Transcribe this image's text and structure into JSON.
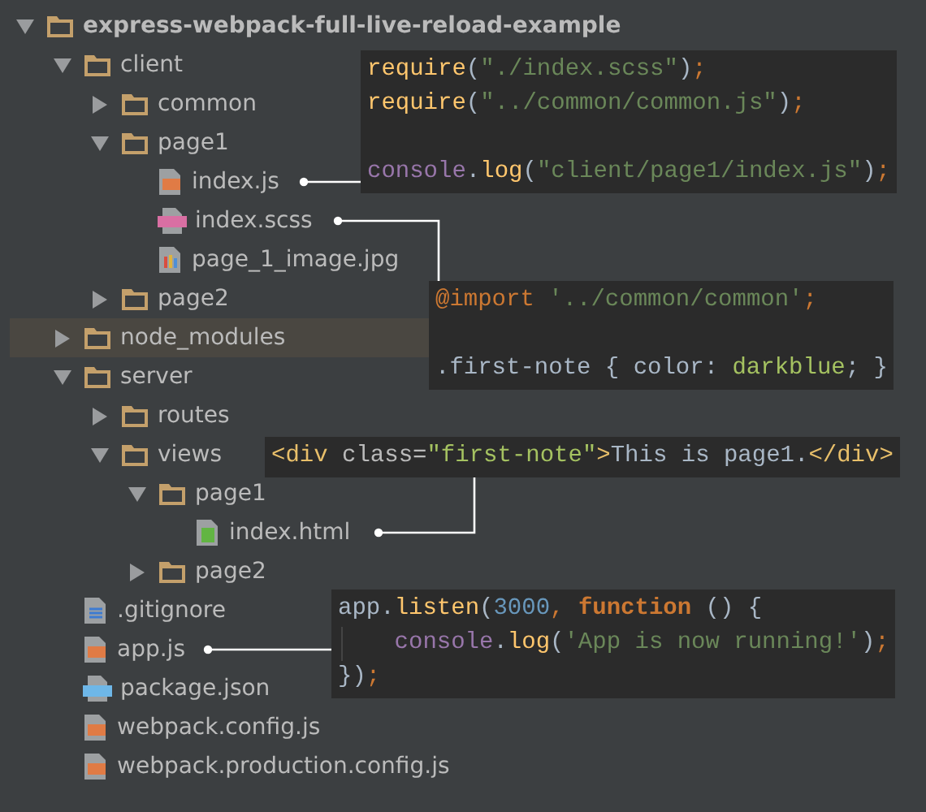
{
  "tree": [
    {
      "label": "express-webpack-full-live-reload-example",
      "kind": "folder",
      "expanded": true,
      "selected": false,
      "children": [
        {
          "label": "client",
          "kind": "folder",
          "expanded": true,
          "selected": false,
          "children": [
            {
              "label": "common",
              "kind": "folder",
              "expanded": false,
              "selected": false
            },
            {
              "label": "page1",
              "kind": "folder",
              "expanded": true,
              "selected": false,
              "children": [
                {
                  "label": "index.js",
                  "kind": "js",
                  "selected": false
                },
                {
                  "label": "index.scss",
                  "kind": "sass",
                  "selected": false
                },
                {
                  "label": "page_1_image.jpg",
                  "kind": "image",
                  "selected": false
                }
              ]
            },
            {
              "label": "page2",
              "kind": "folder",
              "expanded": false,
              "selected": false
            }
          ]
        },
        {
          "label": "node_modules",
          "kind": "folder",
          "expanded": false,
          "selected": true
        },
        {
          "label": "server",
          "kind": "folder",
          "expanded": true,
          "selected": false,
          "children": [
            {
              "label": "routes",
              "kind": "folder",
              "expanded": false,
              "selected": false
            },
            {
              "label": "views",
              "kind": "folder",
              "expanded": true,
              "selected": false,
              "children": [
                {
                  "label": "page1",
                  "kind": "folder",
                  "expanded": true,
                  "selected": false,
                  "children": [
                    {
                      "label": "index.html",
                      "kind": "html",
                      "selected": false
                    }
                  ]
                },
                {
                  "label": "page2",
                  "kind": "folder",
                  "expanded": false,
                  "selected": false
                }
              ]
            }
          ]
        },
        {
          "label": ".gitignore",
          "kind": "text",
          "selected": false
        },
        {
          "label": "app.js",
          "kind": "js",
          "selected": false
        },
        {
          "label": "package.json",
          "kind": "json",
          "selected": false
        },
        {
          "label": "webpack.config.js",
          "kind": "js",
          "selected": false
        },
        {
          "label": "webpack.production.config.js",
          "kind": "js",
          "selected": false
        }
      ]
    }
  ],
  "code_notes": [
    {
      "lines": [
        {
          "spaced": false,
          "indent": false,
          "tokens": [
            {
              "text": "require",
              "kind": "fn"
            },
            {
              "text": "(",
              "kind": "plain"
            },
            {
              "text": "\"./index.scss\"",
              "kind": "str"
            },
            {
              "text": ")",
              "kind": "plain"
            },
            {
              "text": ";",
              "kind": "punct"
            }
          ]
        },
        {
          "spaced": false,
          "indent": false,
          "tokens": [
            {
              "text": "require",
              "kind": "fn"
            },
            {
              "text": "(",
              "kind": "plain"
            },
            {
              "text": "\"../common/common.js\"",
              "kind": "str"
            },
            {
              "text": ")",
              "kind": "plain"
            },
            {
              "text": ";",
              "kind": "punct"
            }
          ]
        },
        {
          "spaced": true,
          "indent": false,
          "tokens": [
            {
              "text": "console",
              "kind": "obj"
            },
            {
              "text": ".",
              "kind": "plain"
            },
            {
              "text": "log",
              "kind": "fn"
            },
            {
              "text": "(",
              "kind": "plain"
            },
            {
              "text": "\"client/page1/index.js\"",
              "kind": "str"
            },
            {
              "text": ")",
              "kind": "plain"
            },
            {
              "text": ";",
              "kind": "punct"
            }
          ]
        }
      ]
    },
    {
      "lines": [
        {
          "spaced": false,
          "indent": false,
          "tokens": [
            {
              "text": "@import",
              "kind": "at"
            },
            {
              "text": " '../common/common'",
              "kind": "str"
            },
            {
              "text": ";",
              "kind": "punct"
            }
          ]
        },
        {
          "spaced": true,
          "indent": false,
          "tokens": [
            {
              "text": ".first-note { color: ",
              "kind": "plain"
            },
            {
              "text": "darkblue",
              "kind": "val"
            },
            {
              "text": "; }",
              "kind": "plain"
            }
          ]
        }
      ]
    },
    {
      "lines": [
        {
          "spaced": false,
          "indent": false,
          "tokens": [
            {
              "text": "<div ",
              "kind": "tag"
            },
            {
              "text": "class=",
              "kind": "attr"
            },
            {
              "text": "\"first-note\"",
              "kind": "val"
            },
            {
              "text": ">",
              "kind": "tag"
            },
            {
              "text": "This is page1.",
              "kind": "plain"
            },
            {
              "text": "</div>",
              "kind": "tag"
            }
          ]
        }
      ]
    },
    {
      "lines": [
        {
          "spaced": false,
          "indent": false,
          "tokens": [
            {
              "text": "app.",
              "kind": "plain"
            },
            {
              "text": "listen",
              "kind": "fn"
            },
            {
              "text": "(",
              "kind": "plain"
            },
            {
              "text": "3000",
              "kind": "num"
            },
            {
              "text": ", ",
              "kind": "punct"
            },
            {
              "text": "function",
              "kind": "kw"
            },
            {
              "text": " () {",
              "kind": "plain"
            }
          ]
        },
        {
          "spaced": false,
          "indent": true,
          "tokens": [
            {
              "text": "console",
              "kind": "obj"
            },
            {
              "text": ".",
              "kind": "plain"
            },
            {
              "text": "log",
              "kind": "fn"
            },
            {
              "text": "(",
              "kind": "plain"
            },
            {
              "text": "'App is now running!'",
              "kind": "str"
            },
            {
              "text": ")",
              "kind": "plain"
            },
            {
              "text": ";",
              "kind": "punct"
            }
          ]
        },
        {
          "spaced": false,
          "indent": false,
          "tokens": [
            {
              "text": "})",
              "kind": "plain"
            },
            {
              "text": ";",
              "kind": "punct"
            }
          ]
        }
      ]
    }
  ]
}
